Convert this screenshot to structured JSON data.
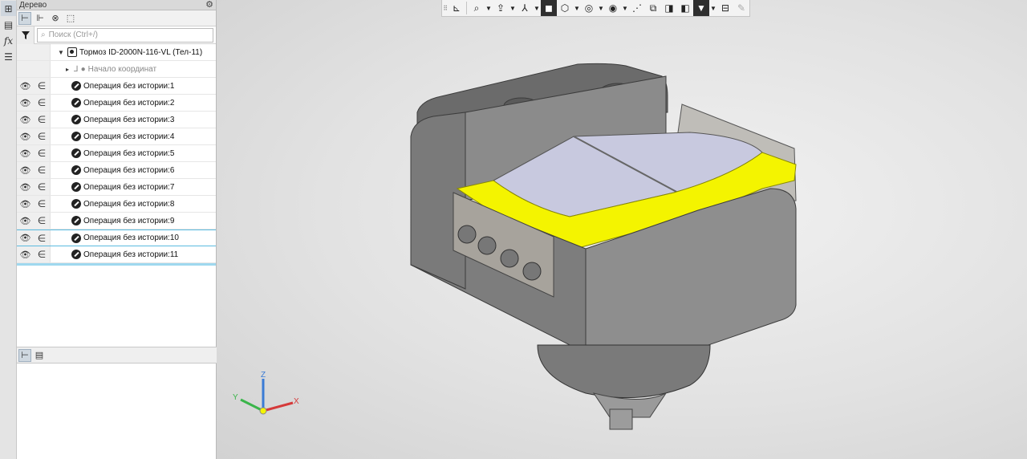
{
  "tree_panel": {
    "title": "Дерево",
    "search_placeholder": "Поиск (Ctrl+/)",
    "root_label": "Тормоз ID-2000N-116-VL (Тел-11)",
    "origin_label": "Начало координат",
    "operations": [
      "Операция без истории:1",
      "Операция без истории:2",
      "Операция без истории:3",
      "Операция без истории:4",
      "Операция без истории:5",
      "Операция без истории:6",
      "Операция без истории:7",
      "Операция без истории:8",
      "Операция без истории:9",
      "Операция без истории:10",
      "Операция без истории:11"
    ]
  },
  "left_strip": {
    "fx_label": "fx"
  },
  "axes": {
    "x": "X",
    "y": "Y",
    "z": "Z"
  },
  "colors": {
    "yellow_part": "#f4f400",
    "body_gray": "#8a8a8a",
    "plate": "#c9cbdf",
    "selection": "#5bbbe0"
  }
}
